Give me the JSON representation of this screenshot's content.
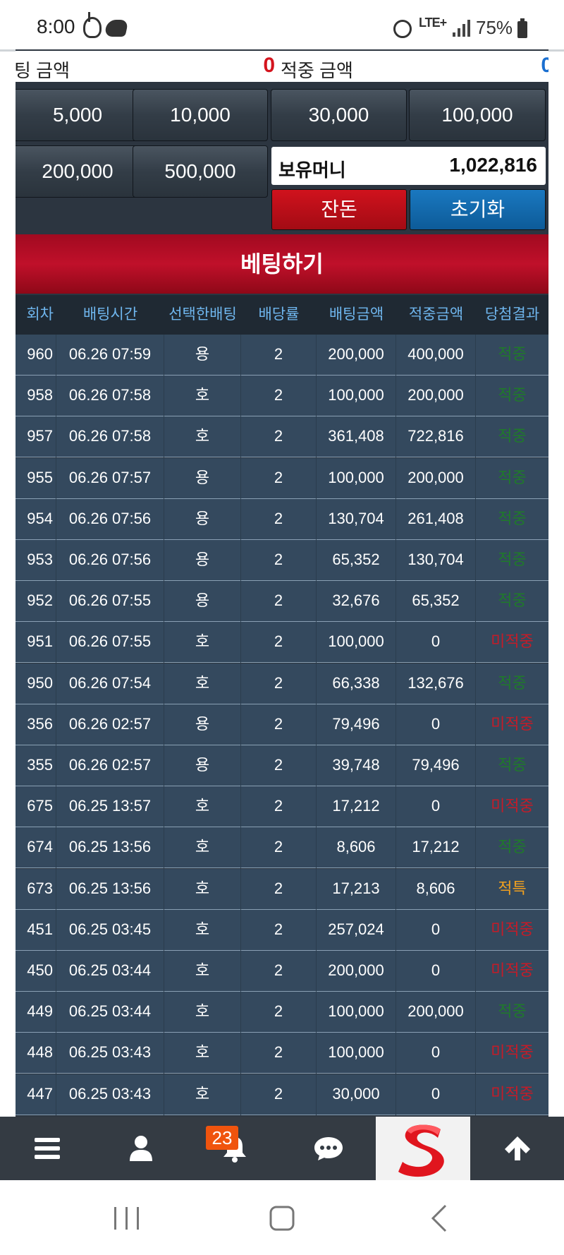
{
  "status_bar": {
    "time": "8:00",
    "network": "LTE+",
    "battery": "75%",
    "icons": [
      "b-icon",
      "cloud-icon",
      "alarm-icon",
      "signal-icon",
      "battery-icon"
    ]
  },
  "amounts": {
    "bet_label": "팅 금액",
    "bet_value": "0",
    "win_label": "적중 금액",
    "win_value": "0"
  },
  "chips": [
    "5,000",
    "10,000",
    "30,000",
    "100,000",
    "200,000",
    "500,000"
  ],
  "money": {
    "label": "보유머니",
    "value": "1,022,816"
  },
  "buttons": {
    "half": "잔돈",
    "reset": "초기화",
    "bet": "베팅하기"
  },
  "table": {
    "headers": {
      "round": "회차",
      "time": "배팅시간",
      "selection": "선택한배팅",
      "odds": "배당률",
      "bet": "배팅금액",
      "win": "적중금액",
      "result": "당첨결과"
    },
    "rows": [
      {
        "round": "960",
        "time": "06.26 07:59",
        "selection": "용",
        "odds": "2",
        "bet": "200,000",
        "win": "400,000",
        "result": "적중",
        "status": "hit"
      },
      {
        "round": "958",
        "time": "06.26 07:58",
        "selection": "호",
        "odds": "2",
        "bet": "100,000",
        "win": "200,000",
        "result": "적중",
        "status": "hit"
      },
      {
        "round": "957",
        "time": "06.26 07:58",
        "selection": "호",
        "odds": "2",
        "bet": "361,408",
        "win": "722,816",
        "result": "적중",
        "status": "hit"
      },
      {
        "round": "955",
        "time": "06.26 07:57",
        "selection": "용",
        "odds": "2",
        "bet": "100,000",
        "win": "200,000",
        "result": "적중",
        "status": "hit"
      },
      {
        "round": "954",
        "time": "06.26 07:56",
        "selection": "용",
        "odds": "2",
        "bet": "130,704",
        "win": "261,408",
        "result": "적중",
        "status": "hit"
      },
      {
        "round": "953",
        "time": "06.26 07:56",
        "selection": "용",
        "odds": "2",
        "bet": "65,352",
        "win": "130,704",
        "result": "적중",
        "status": "hit"
      },
      {
        "round": "952",
        "time": "06.26 07:55",
        "selection": "용",
        "odds": "2",
        "bet": "32,676",
        "win": "65,352",
        "result": "적중",
        "status": "hit"
      },
      {
        "round": "951",
        "time": "06.26 07:55",
        "selection": "호",
        "odds": "2",
        "bet": "100,000",
        "win": "0",
        "result": "미적중",
        "status": "miss"
      },
      {
        "round": "950",
        "time": "06.26 07:54",
        "selection": "호",
        "odds": "2",
        "bet": "66,338",
        "win": "132,676",
        "result": "적중",
        "status": "hit"
      },
      {
        "round": "356",
        "time": "06.26 02:57",
        "selection": "용",
        "odds": "2",
        "bet": "79,496",
        "win": "0",
        "result": "미적중",
        "status": "miss"
      },
      {
        "round": "355",
        "time": "06.26 02:57",
        "selection": "용",
        "odds": "2",
        "bet": "39,748",
        "win": "79,496",
        "result": "적중",
        "status": "hit"
      },
      {
        "round": "675",
        "time": "06.25 13:57",
        "selection": "호",
        "odds": "2",
        "bet": "17,212",
        "win": "0",
        "result": "미적중",
        "status": "miss"
      },
      {
        "round": "674",
        "time": "06.25 13:56",
        "selection": "호",
        "odds": "2",
        "bet": "8,606",
        "win": "17,212",
        "result": "적중",
        "status": "hit"
      },
      {
        "round": "673",
        "time": "06.25 13:56",
        "selection": "호",
        "odds": "2",
        "bet": "17,213",
        "win": "8,606",
        "result": "적특",
        "status": "spec"
      },
      {
        "round": "451",
        "time": "06.25 03:45",
        "selection": "호",
        "odds": "2",
        "bet": "257,024",
        "win": "0",
        "result": "미적중",
        "status": "miss"
      },
      {
        "round": "450",
        "time": "06.25 03:44",
        "selection": "호",
        "odds": "2",
        "bet": "200,000",
        "win": "0",
        "result": "미적중",
        "status": "miss"
      },
      {
        "round": "449",
        "time": "06.25 03:44",
        "selection": "호",
        "odds": "2",
        "bet": "100,000",
        "win": "200,000",
        "result": "적중",
        "status": "hit"
      },
      {
        "round": "448",
        "time": "06.25 03:43",
        "selection": "호",
        "odds": "2",
        "bet": "100,000",
        "win": "0",
        "result": "미적중",
        "status": "miss"
      },
      {
        "round": "447",
        "time": "06.25 03:43",
        "selection": "호",
        "odds": "2",
        "bet": "30,000",
        "win": "0",
        "result": "미적중",
        "status": "miss"
      }
    ]
  },
  "bottom_nav": {
    "items": [
      "menu-icon",
      "user-icon",
      "bell-icon",
      "chat-icon",
      "logo",
      "arrow-up-icon"
    ],
    "notification_count": "23"
  },
  "colors": {
    "hit": "#1f7a2a",
    "miss": "#c41c28",
    "special": "#f0a020",
    "bet_bar": "#b00e24",
    "reset": "#1a78c0",
    "header_text": "#6fb6ee"
  }
}
